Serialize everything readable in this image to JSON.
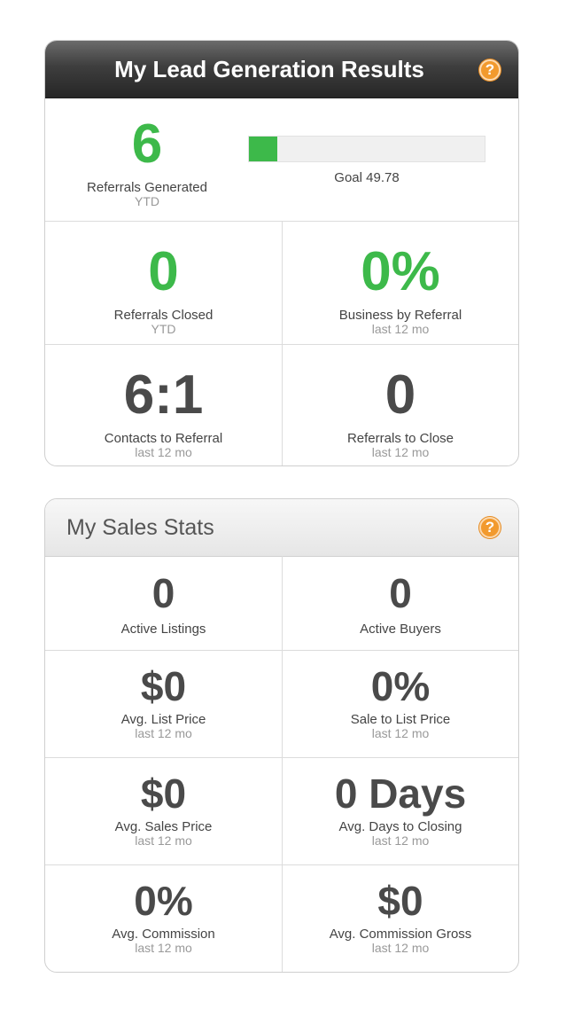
{
  "colors": {
    "accent_green": "#3db94a",
    "help_orange": "#f29a2e",
    "header_dark": "#3e3e3e",
    "header_light": "#eeeeee"
  },
  "lead_card": {
    "title": "My Lead Generation Results",
    "help_icon": "question-mark-icon",
    "help_glyph": "?",
    "referrals_generated": {
      "value": "6",
      "label": "Referrals Generated",
      "sub": "YTD"
    },
    "progress": {
      "fraction": 0.12,
      "goal_text": "Goal 49.78"
    },
    "referrals_closed": {
      "value": "0",
      "label": "Referrals Closed",
      "sub": "YTD"
    },
    "business_by_referral": {
      "value": "0%",
      "label": "Business by Referral",
      "sub": "last 12 mo"
    },
    "contacts_to_referral": {
      "value": "6:1",
      "label": "Contacts to Referral",
      "sub": "last 12 mo"
    },
    "referrals_to_close": {
      "value": "0",
      "label": "Referrals to Close",
      "sub": "last 12 mo"
    }
  },
  "sales_card": {
    "title": "My Sales Stats",
    "help_icon": "question-mark-icon",
    "help_glyph": "?",
    "active_listings": {
      "value": "0",
      "label": "Active Listings"
    },
    "active_buyers": {
      "value": "0",
      "label": "Active Buyers"
    },
    "avg_list_price": {
      "value": "$0",
      "label": "Avg. List Price",
      "sub": "last 12 mo"
    },
    "sale_to_list": {
      "value": "0%",
      "label": "Sale to List Price",
      "sub": "last 12 mo"
    },
    "avg_sales_price": {
      "value": "$0",
      "label": "Avg. Sales Price",
      "sub": "last 12 mo"
    },
    "avg_days_closing": {
      "value": "0 Days",
      "label": "Avg. Days to Closing",
      "sub": "last 12 mo"
    },
    "avg_commission": {
      "value": "0%",
      "label": "Avg. Commission",
      "sub": "last 12 mo"
    },
    "avg_commission_gross": {
      "value": "$0",
      "label": "Avg. Commission Gross",
      "sub": "last 12 mo"
    }
  }
}
